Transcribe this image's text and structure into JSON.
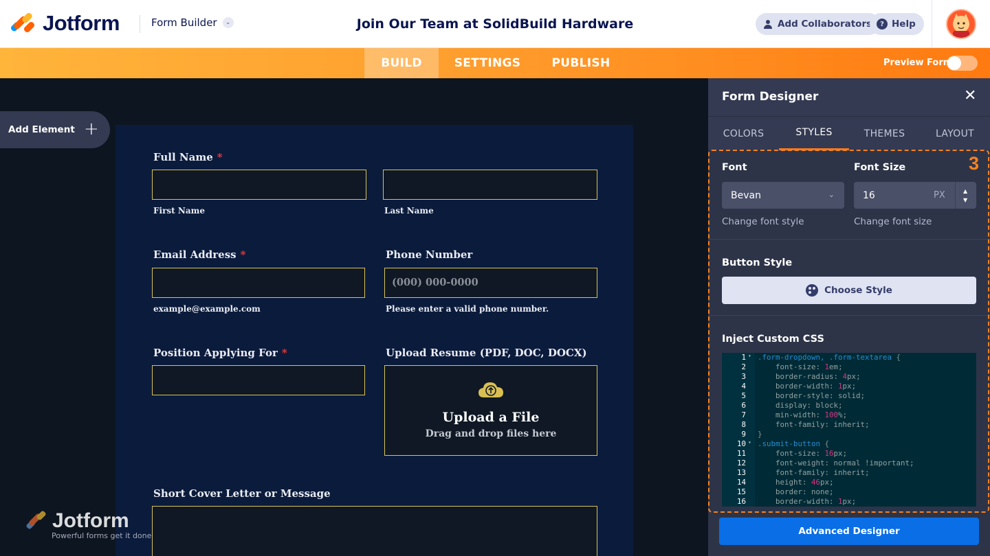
{
  "app": {
    "brand": "Jotform",
    "mode_label": "Form Builder",
    "form_title": "Join Our Team at SolidBuild Hardware",
    "add_collaborators": "Add Collaborators",
    "help": "Help",
    "colors": {
      "accent": "#ff7a10",
      "brand_navy": "#0a1551",
      "primary_button": "#0a6ee6",
      "highlight": "#f58220"
    }
  },
  "nav": {
    "tabs": [
      {
        "label": "BUILD",
        "active": true
      },
      {
        "label": "SETTINGS",
        "active": false
      },
      {
        "label": "PUBLISH",
        "active": false
      }
    ],
    "preview_label": "Preview Form",
    "preview_on": false
  },
  "canvas": {
    "add_element": "Add Element",
    "watermark": {
      "brand": "Jotform",
      "tagline": "Powerful forms get it done"
    }
  },
  "form": {
    "full_name": {
      "label": "Full Name",
      "required": "*",
      "first": "First Name",
      "last": "Last Name"
    },
    "email": {
      "label": "Email Address",
      "required": "*",
      "sublabel": "example@example.com"
    },
    "phone": {
      "label": "Phone Number",
      "placeholder": "(000) 000-0000",
      "sublabel": "Please enter a valid phone number."
    },
    "position": {
      "label": "Position Applying For",
      "required": "*"
    },
    "resume": {
      "label": "Upload Resume (PDF, DOC, DOCX)",
      "title": "Upload a File",
      "hint": "Drag and drop files here"
    },
    "cover": {
      "label": "Short Cover Letter or Message"
    }
  },
  "designer": {
    "title": "Form Designer",
    "tabs": [
      {
        "label": "COLORS",
        "active": false
      },
      {
        "label": "STYLES",
        "active": true
      },
      {
        "label": "THEMES",
        "active": false
      },
      {
        "label": "LAYOUT",
        "active": false
      }
    ],
    "step_badge": "3",
    "font": {
      "label": "Font",
      "value": "Bevan",
      "help": "Change font style"
    },
    "font_size": {
      "label": "Font Size",
      "value": "16",
      "unit": "PX",
      "help": "Change font size"
    },
    "button_style": {
      "label": "Button Style",
      "button": "Choose Style"
    },
    "css": {
      "label": "Inject Custom CSS",
      "lines": [
        ".form-dropdown, .form-textarea {",
        "    font-size: 1em;",
        "    border-radius: 4px;",
        "    border-width: 1px;",
        "    border-style: solid;",
        "    display: block;",
        "    min-width: 100%;",
        "    font-family: inherit;",
        "}",
        ".submit-button {",
        "    font-size: 16px;",
        "    font-weight: normal !important;",
        "    font-family: inherit;",
        "    height: 46px;",
        "    border: none;",
        "    border-width: 1px;"
      ],
      "line_numbers": [
        "1",
        "2",
        "3",
        "4",
        "5",
        "6",
        "7",
        "8",
        "9",
        "10",
        "11",
        "12",
        "13",
        "14",
        "15",
        "16"
      ]
    },
    "advanced": "Advanced Designer"
  }
}
